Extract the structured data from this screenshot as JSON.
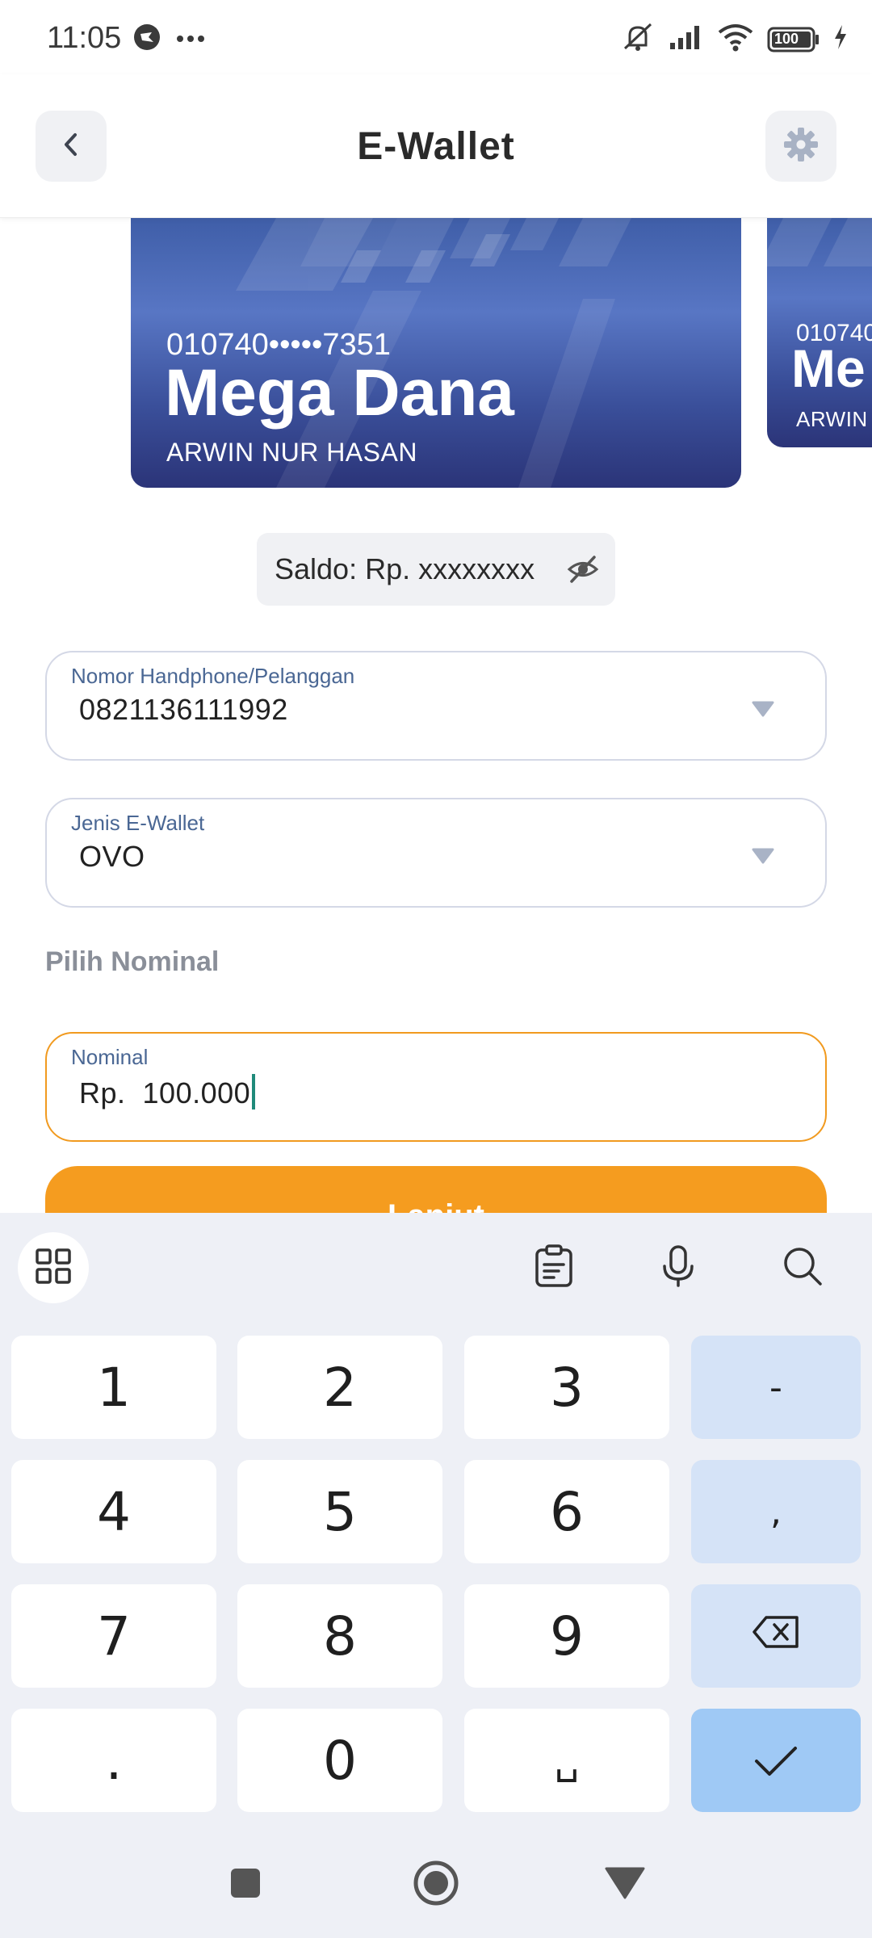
{
  "status_bar": {
    "time": "11:05",
    "left_icons": [
      "app-notification-icon",
      "more-dots-icon"
    ],
    "right_icons": [
      "muted-bell-icon",
      "signal-icon",
      "wifi-icon",
      "battery-icon",
      "charging-icon"
    ],
    "battery_level": "100"
  },
  "header": {
    "title": "E-Wallet",
    "back_icon": "chevron-left-icon",
    "settings_icon": "gear-icon"
  },
  "cards": [
    {
      "number": "010740•••••7351",
      "name": "Mega Dana",
      "holder": "ARWIN NUR HASAN"
    },
    {
      "number": "010740",
      "name": "Me",
      "holder": "ARWIN N"
    }
  ],
  "saldo": {
    "text": "Saldo: Rp. xxxxxxxx",
    "toggle_icon": "eye-off-icon"
  },
  "form": {
    "phone": {
      "label": "Nomor Handphone/Pelanggan",
      "value": "0821136111992"
    },
    "wallet": {
      "label": "Jenis E-Wallet",
      "value": "OVO"
    },
    "section_label": "Pilih Nominal",
    "nominal": {
      "label": "Nominal",
      "value": "Rp.  100.000"
    },
    "submit_label": "Lanjut"
  },
  "keyboard": {
    "toolbar": [
      "grid-icon",
      "clipboard-icon",
      "mic-icon",
      "search-icon"
    ],
    "rows": [
      [
        "1",
        "2",
        "3",
        "-"
      ],
      [
        "4",
        "5",
        "6",
        ","
      ],
      [
        "7",
        "8",
        "9",
        "backspace"
      ],
      [
        ".",
        "0",
        "␣",
        "done"
      ]
    ],
    "colors": {
      "key_bg": "#ffffff",
      "fn_bg": "#d5e3f7",
      "done_bg": "#9fc9f5",
      "panel_bg": "#eef0f6"
    }
  },
  "nav_bar": {
    "icons": [
      "square-recents-icon",
      "circle-home-icon",
      "triangle-back-icon"
    ]
  },
  "colors": {
    "accent": "#f59c1f",
    "card_blue": "#3f5ea8",
    "label_blue": "#4a6794"
  }
}
